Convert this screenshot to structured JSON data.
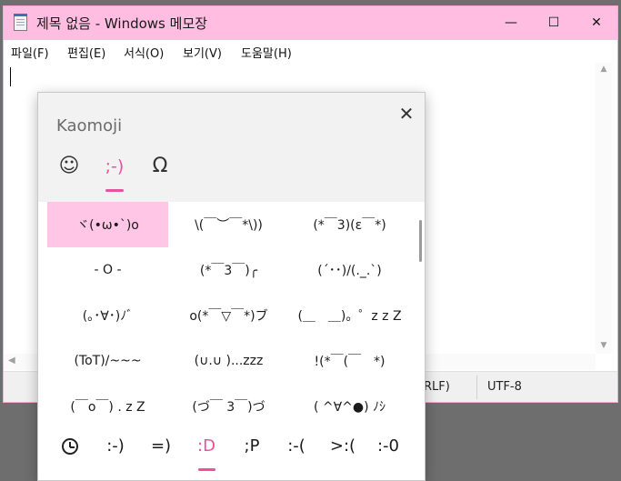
{
  "colors": {
    "accent": "#e8539f",
    "titlebar": "#ffbde2",
    "selection": "#ffc6e6"
  },
  "window": {
    "title": "제목 없음 - Windows 메모장",
    "app_icon": "notepad-icon",
    "controls": {
      "minimize": "—",
      "maximize": "☐",
      "close": "✕"
    }
  },
  "menu": [
    "파일(F)",
    "편집(E)",
    "서식(O)",
    "보기(V)",
    "도움말(H)"
  ],
  "status": {
    "line_ending": "RLF)",
    "encoding": "UTF-8"
  },
  "panel": {
    "title": "Kaomoji",
    "close_glyph": "✕",
    "categories": [
      {
        "icon": "smiley-icon",
        "glyph": "☺"
      },
      {
        "icon": "kaomoji-icon",
        "glyph": ";-)",
        "active": true
      },
      {
        "icon": "omega-symbol-icon",
        "glyph": "Ω"
      }
    ],
    "kaomoji": [
      "ヾ(•ω•`)o",
      "\\(￣︶￣*\\))",
      "(*￣3)(ε￣*)",
      "- O -",
      "(*￣3￣)╭",
      "(´･･)/(._.`)",
      "(｡･∀･)ﾉﾞ",
      "o(*￣▽￣*)ブ",
      "(＿　＿)。゜z z Z",
      "(ToT)/~~~",
      "(∪.∪ )...zzz",
      "!(*￣(￣　*)",
      "(￣o￣) . z Z",
      "(づ￣ 3￣)づ",
      "( ^∀^●) ﾉｼ"
    ],
    "bottom_tabs": [
      {
        "icon": "recent-clock-icon"
      },
      {
        "label": ":-)"
      },
      {
        "label": "=)"
      },
      {
        "label": ":D",
        "active": true
      },
      {
        "label": ";P"
      },
      {
        "label": ":-("
      },
      {
        "label": ">:("
      },
      {
        "label": ":-0"
      }
    ]
  }
}
